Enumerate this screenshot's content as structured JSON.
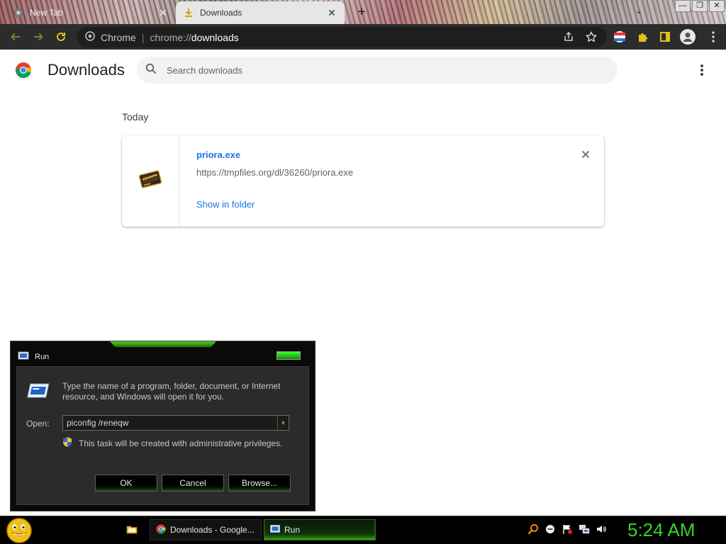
{
  "browser": {
    "tabs": [
      {
        "title": "New Tab",
        "active": false,
        "icon": "chrome-icon"
      },
      {
        "title": "Downloads",
        "active": true,
        "icon": "download-icon"
      }
    ],
    "new_tab_symbol": "+",
    "window_controls": [
      "—",
      "❐",
      "✕"
    ],
    "omnibox": {
      "site_label": "Chrome",
      "separator": "|",
      "url_scheme": "chrome://",
      "url_host": "downloads"
    }
  },
  "downloads_page": {
    "title": "Downloads",
    "search_placeholder": "Search downloads",
    "section_label": "Today",
    "items": [
      {
        "file_name": "priora.exe",
        "url": "https://tmpfiles.org/dl/36260/priora.exe",
        "action_label": "Show in folder"
      }
    ]
  },
  "run_dialog": {
    "title": "Run",
    "description": "Type the name of a program, folder, document, or Internet resource, and Windows will open it for you.",
    "open_label": "Open:",
    "input_value": "piconfig /reneqw",
    "admin_note": "This task will be created with administrative privileges.",
    "buttons": {
      "ok": "OK",
      "cancel": "Cancel",
      "browse": "Browse..."
    }
  },
  "taskbar": {
    "items": [
      {
        "label": "Downloads - Google...",
        "icon": "chrome-icon"
      },
      {
        "label": "Run",
        "icon": "run-icon"
      }
    ],
    "clock": "5:24 AM"
  },
  "colors": {
    "link_blue": "#1a73e8",
    "accent_green": "#3bd12a",
    "toolbar_bg": "#2c2c2c"
  }
}
